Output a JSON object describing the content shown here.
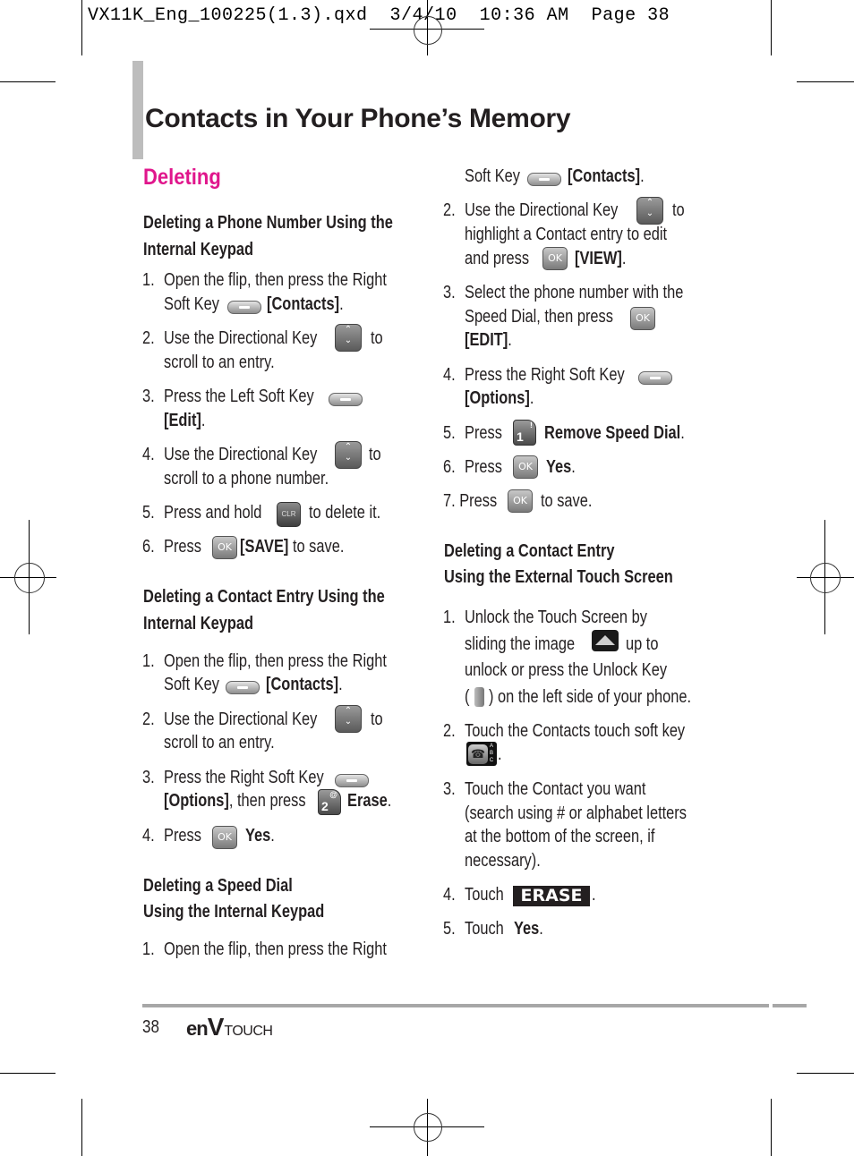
{
  "slug": "VX11K_Eng_100225(1.3).qxd  3/4/10  10:36 AM  Page 38",
  "page_title": "Contacts in Your Phone’s Memory",
  "section_title": "Deleting",
  "accent_color": "#e0168c",
  "left": {
    "sub1": {
      "heading_line1": "Deleting a Phone Number Using the",
      "heading_line2": "Internal Keypad",
      "s1_num": "1.",
      "s1_a": "Open the flip, then press the Right",
      "s1_b": "Soft Key",
      "s1_c": "[Contacts]",
      "s1_d": ".",
      "s2_num": "2.",
      "s2_a": "Use the Directional Key",
      "s2_b": "to",
      "s2_c": "scroll to an entry.",
      "s3_num": "3.",
      "s3_a": "Press the Left Soft Key",
      "s3_b": "[Edit]",
      "s3_c": ".",
      "s4_num": "4.",
      "s4_a": "Use the Directional Key",
      "s4_b": "to",
      "s4_c": "scroll to a phone number.",
      "s5_num": "5.",
      "s5_a": "Press and hold",
      "s5_b": "to delete it.",
      "s6_num": "6.",
      "s6_a": "Press",
      "s6_b": "[SAVE]",
      "s6_c": "to save."
    },
    "sub2": {
      "heading_line1": "Deleting a Contact Entry Using the",
      "heading_line2": "Internal Keypad",
      "s1_num": "1.",
      "s1_a": "Open the flip, then press the Right",
      "s1_b": "Soft Key",
      "s1_c": "[Contacts]",
      "s1_d": ".",
      "s2_num": "2.",
      "s2_a": "Use the Directional Key",
      "s2_b": "to",
      "s2_c": "scroll to an entry.",
      "s3_num": "3.",
      "s3_a": "Press the Right Soft Key",
      "s3_b": "[Options]",
      "s3_c": ", then press",
      "s3_d": "Erase",
      "s3_e": ".",
      "s4_num": "4.",
      "s4_a": "Press",
      "s4_b": "Yes",
      "s4_c": "."
    },
    "sub3": {
      "heading_line1": "Deleting a Speed Dial",
      "heading_line2": "Using the Internal Keypad",
      "s1_num": "1.",
      "s1_a": "Open the flip, then press the Right"
    }
  },
  "right": {
    "sub3_cont": {
      "s1_b": "Soft Key",
      "s1_c": "[Contacts]",
      "s1_d": ".",
      "s2_num": "2.",
      "s2_a": "Use the Directional Key",
      "s2_b": "to",
      "s2_c": "highlight a Contact entry to edit",
      "s2_d": "and press",
      "s2_e": "[VIEW]",
      "s2_f": ".",
      "s3_num": "3.",
      "s3_a": "Select the phone number with the",
      "s3_b": "Speed Dial, then press",
      "s3_c": "[EDIT]",
      "s3_d": ".",
      "s4_num": "4.",
      "s4_a": "Press the Right Soft Key",
      "s4_b": "[Options]",
      "s4_c": ".",
      "s5_num": "5.",
      "s5_a": "Press",
      "s5_b": "Remove Speed Dial",
      "s5_c": ".",
      "s6_num": "6.",
      "s6_a": "Press",
      "s6_b": "Yes",
      "s6_c": ".",
      "s7": "7. Press",
      "s7_b": "to save."
    },
    "sub4": {
      "heading_line1": "Deleting a Contact Entry",
      "heading_line2": "Using the External Touch Screen",
      "s1_num": "1.",
      "s1_a": "Unlock the Touch Screen by",
      "s1_b": "sliding the image",
      "s1_c": "up to",
      "s1_d": "unlock or press the Unlock Key",
      "s1_e": "(",
      "s1_f": ") on the left side of your phone.",
      "s2_num": "2.",
      "s2_a": "Touch the Contacts touch soft key",
      "s2_b": ".",
      "s3_num": "3.",
      "s3_a": "Touch the Contact you want",
      "s3_b": "(search using # or alphabet letters",
      "s3_c": "at the bottom of the screen, if",
      "s3_d": "necessary).",
      "s4_num": "4.",
      "s4_a": "Touch",
      "s4_btn": "ERASE",
      "s4_c": ".",
      "s5_num": "5.",
      "s5_a": "Touch",
      "s5_b": "Yes",
      "s5_c": "."
    }
  },
  "keys": {
    "ok": "OK",
    "clr": "CLR",
    "num2": "2",
    "num2_sub": "@",
    "num1": "1",
    "num1_sub": "!",
    "contacts_abc": "A B C",
    "phone_glyph": "☎"
  },
  "footer": {
    "page_number": "38",
    "brand_en": "en",
    "brand_v": "V",
    "brand_touch": "TOUCH"
  }
}
